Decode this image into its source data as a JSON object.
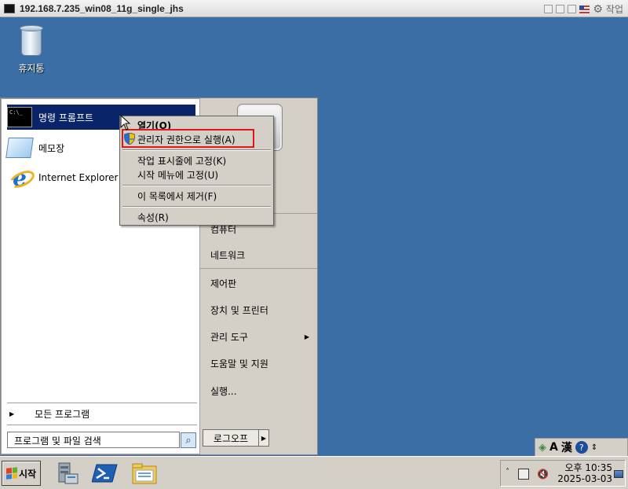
{
  "window": {
    "title": "192.168.7.235_win08_11g_single_jhs",
    "menu_label": "작업"
  },
  "desktop": {
    "recycle_bin_label": "휴지통"
  },
  "start_menu": {
    "pinned": [
      {
        "label": "명령 프롬프트",
        "icon": "cmd-icon",
        "icon_text": "C:\\_"
      },
      {
        "label": "메모장",
        "icon": "notepad-icon"
      },
      {
        "label": "Internet Explorer",
        "icon": "ie-icon"
      }
    ],
    "all_programs": "모든 프로그램",
    "search_placeholder": "프로그램 및 파일 검색",
    "right_items": [
      {
        "label": "컴퓨터"
      },
      {
        "label": "네트워크"
      },
      {
        "label": "제어판"
      },
      {
        "label": "장치 및 프린터"
      },
      {
        "label": "관리 도구"
      },
      {
        "label": "도움말 및 지원"
      },
      {
        "label": "실행..."
      }
    ],
    "logoff_label": "로그오프"
  },
  "context_menu": {
    "items": [
      {
        "label": "열기(O)"
      },
      {
        "label": "관리자 권한으로 실행(A)"
      },
      {
        "label": "작업 표시줄에 고정(K)"
      },
      {
        "label": "시작 메뉴에 고정(U)"
      },
      {
        "label": "이 목록에서 제거(F)"
      },
      {
        "label": "속성(R)"
      }
    ]
  },
  "language_bar": {
    "mode_a": "A",
    "mode_han": "漢",
    "help": "?"
  },
  "taskbar": {
    "start_label": "시작",
    "clock_time": "오후 10:35",
    "clock_date": "2025-03-03"
  },
  "colors": {
    "desktop": "#3a6ea5",
    "selection": "#0a246a",
    "highlight_box": "#e01818"
  }
}
